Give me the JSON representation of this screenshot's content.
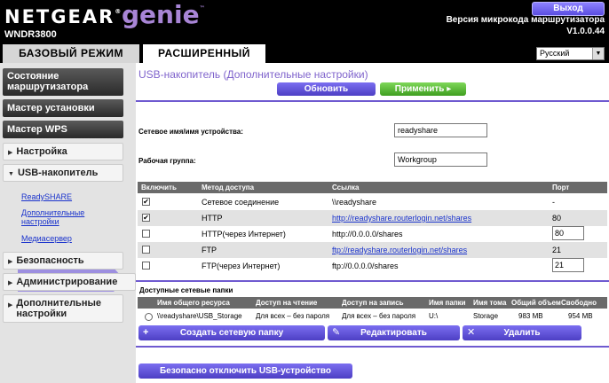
{
  "header": {
    "logo": "NETGEAR",
    "product": "genie",
    "model": "WNDR3800",
    "logout_label": "Выход",
    "firmware_label": "Версия микрокода маршрутизатора",
    "firmware_version": "V1.0.0.44",
    "tabs": [
      "БАЗОВЫЙ РЕЖИМ",
      "РАСШИРЕННЫЙ"
    ],
    "language": "Русский"
  },
  "sidebar": {
    "items": [
      {
        "label": "Состояние маршрутизатора"
      },
      {
        "label": "Мастер установки"
      },
      {
        "label": "Мастер WPS"
      },
      {
        "label": "Настройка"
      },
      {
        "label": "USB-накопитель"
      },
      {
        "label": "Безопасность"
      },
      {
        "label": "Администрирование"
      },
      {
        "label": "Дополнительные настройки"
      }
    ],
    "usb_subitems": [
      "ReadySHARE",
      "Дополнительные настройки",
      "Медиасервер"
    ]
  },
  "main": {
    "title": "USB-накопитель (Дополнительные настройки)",
    "refresh_label": "Обновить",
    "apply_label": "Применить ▸",
    "network_name_label": "Сетевое имя/имя устройства:",
    "network_name_value": "readyshare",
    "workgroup_label": "Рабочая группа:",
    "workgroup_value": "Workgroup",
    "access_columns": [
      "Включить",
      "Метод доступа",
      "Ссылка",
      "Порт"
    ],
    "access_rows": [
      {
        "enabled": true,
        "method": "Сетевое соединение",
        "link": "\\\\readyshare",
        "port": "-"
      },
      {
        "enabled": true,
        "method": "HTTP",
        "link": "http://readyshare.routerlogin.net/shares",
        "port": "80"
      },
      {
        "enabled": false,
        "method": "HTTP(через Интернет)",
        "link": "http://0.0.0.0/shares",
        "port": "80"
      },
      {
        "enabled": false,
        "method": "FTP",
        "link": "ftp://readyshare.routerlogin.net/shares",
        "port": "21"
      },
      {
        "enabled": false,
        "method": "FTP(через Интернет)",
        "link": "ftp://0.0.0.0/shares",
        "port": "21"
      }
    ],
    "shares_title": "Доступные сетевые папки",
    "shares_columns": [
      "Имя общего ресурса",
      "Доступ на чтение",
      "Доступ на запись",
      "Имя папки",
      "Имя тома",
      "Общий объем",
      "Свободно"
    ],
    "shares_row": {
      "name": "\\\\readyshare\\USB_Storage",
      "read": "Для всех – без пароля",
      "write": "Для всех – без пароля",
      "folder": "U:\\",
      "volume": "Storage",
      "total": "983 MB",
      "free": "954 MB"
    },
    "create_label": "Создать сетевую папку",
    "edit_label": "Редактировать",
    "delete_label": "Удалить",
    "eject_label": "Безопасно отключить USB-устройство"
  }
}
